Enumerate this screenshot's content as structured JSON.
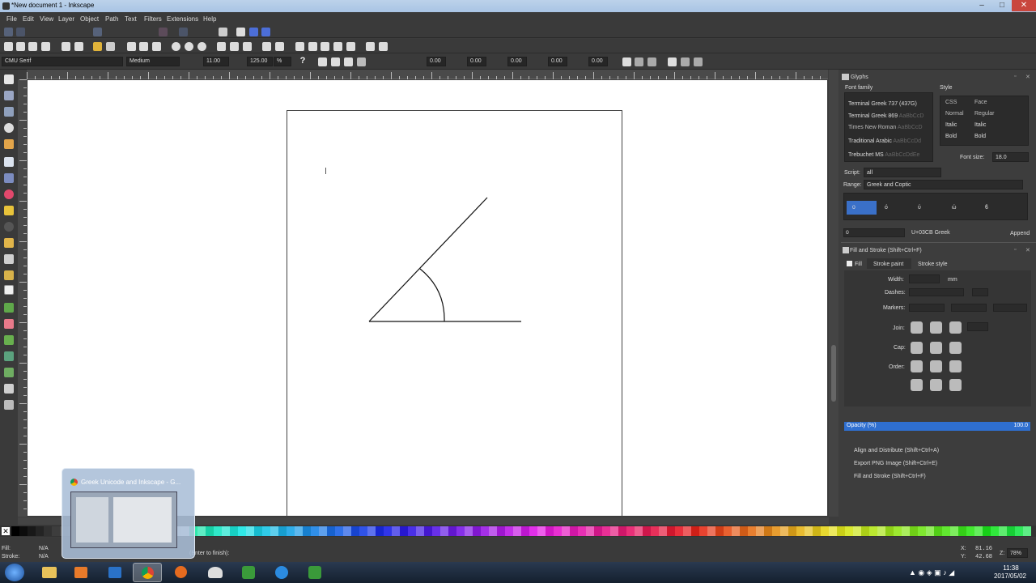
{
  "window": {
    "title": "*New document 1 - Inkscape"
  },
  "menu": [
    "File",
    "Edit",
    "View",
    "Layer",
    "Object",
    "Path",
    "Text",
    "Filters",
    "Extensions",
    "Help"
  ],
  "text_toolbar": {
    "font_family": "CMU Serif",
    "font_style": "Medium",
    "font_size": "11.00",
    "line_spacing": "125.00",
    "line_spacing_unit": "%",
    "help": "?",
    "values": [
      "0.00",
      "0.00",
      "0.00",
      "0.00",
      "0.00"
    ]
  },
  "glyphs": {
    "header": "Glyphs",
    "font_family_label": "Font family",
    "style_label": "Style",
    "families": [
      {
        "name": "Terminal Greek 737 (437G)",
        "sample": ""
      },
      {
        "name": "Terminal Greek 869",
        "sample": "AaBbCcD"
      },
      {
        "name": "Times New Roman",
        "sample": "AaBbCcD"
      },
      {
        "name": "Traditional Arabic",
        "sample": "AaBbCcDd"
      },
      {
        "name": "Trebuchet MS",
        "sample": "AaBbCcDdEe"
      }
    ],
    "style_head": [
      "CSS",
      "Face"
    ],
    "styles": [
      [
        "Normal",
        "Regular"
      ],
      [
        "Italic",
        "Italic"
      ],
      [
        "Bold",
        "Bold"
      ]
    ],
    "font_size_label": "Font size:",
    "font_size": "18.0",
    "script_label": "Script:",
    "script": "all",
    "range_label": "Range:",
    "range": "Greek and Coptic",
    "glyphs": [
      "ϋ",
      "ό",
      "ύ",
      "ώ",
      "ϐ"
    ],
    "selected_code": "U+03CB Greek",
    "input": "ϋ",
    "append": "Append"
  },
  "fill_stroke": {
    "header": "Fill and Stroke (Shift+Ctrl+F)",
    "tabs": [
      "Fill",
      "Stroke paint",
      "Stroke style"
    ],
    "width_label": "Width:",
    "unit": "mm",
    "dashes_label": "Dashes:",
    "markers_label": "Markers:",
    "join_label": "Join:",
    "cap_label": "Cap:",
    "order_label": "Order:",
    "opacity_label": "Opacity (%)",
    "opacity": "100.0",
    "opacity_fraction": 1.0
  },
  "collapsed_panels": [
    "Align and Distribute (Shift+Ctrl+A)",
    "Export PNG Image (Shift+Ctrl+E)",
    "Fill and Stroke (Shift+Ctrl+F)"
  ],
  "status": {
    "fill_label": "Fill:",
    "fill": "N/A",
    "stroke_label": "Stroke:",
    "stroke": "N/A",
    "message": "(Enter to finish):",
    "x_label": "X:",
    "x": "81.16",
    "y_label": "Y:",
    "y": "42.68",
    "z_label": "Z:",
    "zoom": "78%"
  },
  "taskbar": {
    "preview_title": "Greek Unicode and Inkscape - G...",
    "time": "11:38",
    "date": "2017/05/02"
  },
  "colors": {
    "accent": "#3a70c8",
    "opacity_bar": "#2f6fd0",
    "canvas": "#ffffff"
  }
}
